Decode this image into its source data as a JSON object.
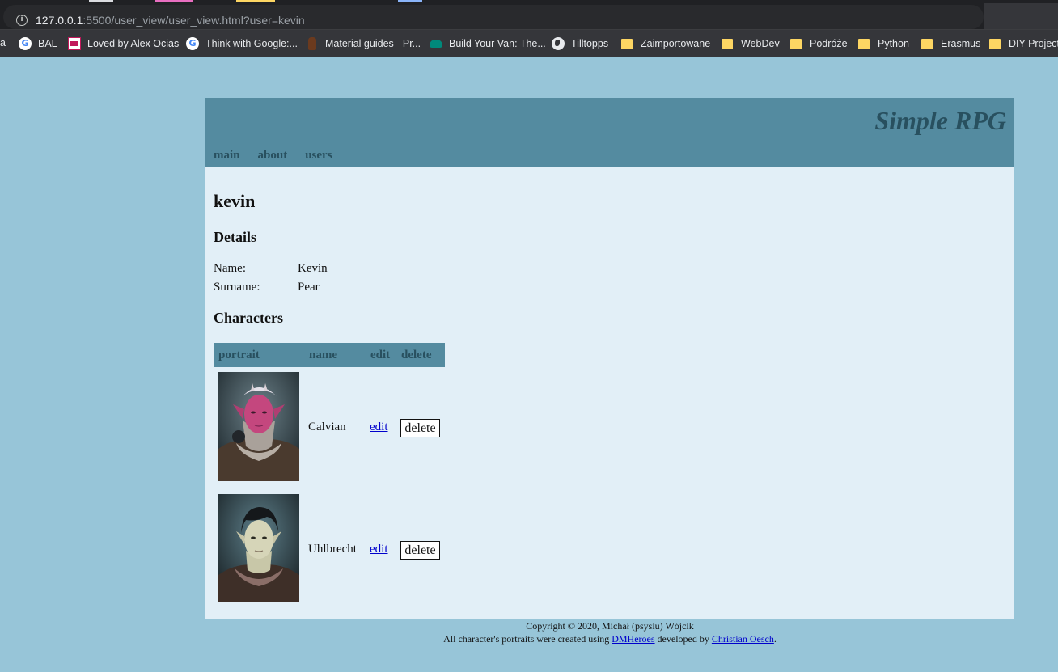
{
  "browser": {
    "url_host": "127.0.0.1",
    "url_rest": ":5500/user_view/user_view.html?user=kevin",
    "bookmarks": [
      {
        "label": "BAL",
        "icon": "google-icon"
      },
      {
        "label": "Loved by Alex Ocias",
        "icon": "alex-ocias-icon"
      },
      {
        "label": "Think with Google:...",
        "icon": "google-icon"
      },
      {
        "label": "Material guides - Pr...",
        "icon": "dog-icon"
      },
      {
        "label": "Build Your Van: The...",
        "icon": "van-icon"
      },
      {
        "label": "Tilltopps",
        "icon": "globe-icon"
      },
      {
        "label": "Zaimportowane",
        "icon": "folder-icon"
      },
      {
        "label": "WebDev",
        "icon": "folder-icon"
      },
      {
        "label": "Podróże",
        "icon": "folder-icon"
      },
      {
        "label": "Python",
        "icon": "folder-icon"
      },
      {
        "label": "Erasmus",
        "icon": "folder-icon"
      },
      {
        "label": "DIY Projects",
        "icon": "folder-icon"
      }
    ],
    "bookmark_cut_label": "a"
  },
  "site": {
    "brand": "Simple RPG",
    "nav": [
      "main",
      "about",
      "users"
    ]
  },
  "user": {
    "username": "kevin",
    "details_title": "Details",
    "name_label": "Name:",
    "name_value": "Kevin",
    "surname_label": "Surname:",
    "surname_value": "Pear"
  },
  "characters": {
    "title": "Characters",
    "headers": [
      "portrait",
      "name",
      "edit",
      "delete"
    ],
    "rows": [
      {
        "name": "Calvian",
        "edit_label": "edit",
        "delete_label": "delete"
      },
      {
        "name": "Uhlbrecht",
        "edit_label": "edit",
        "delete_label": "delete"
      }
    ]
  },
  "footer": {
    "line1": "Copyright © 2020, Michał (psysiu) Wójcik",
    "line2_prefix": "All character's portraits were created using ",
    "link1": "DMHeroes",
    "line2_mid": " developed by ",
    "link2": "Christian Oesch",
    "line2_suffix": "."
  },
  "colors": {
    "page_bg": "#97c5d8",
    "header_bg": "#548ba0",
    "header_text": "#28505f",
    "content_bg": "#e2eff7"
  }
}
